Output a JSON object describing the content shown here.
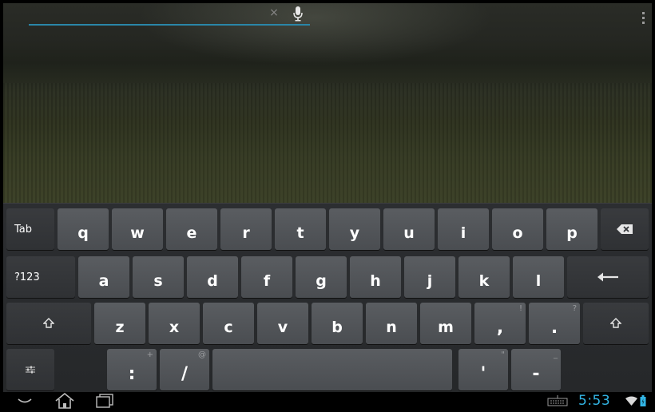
{
  "search": {
    "value": "",
    "placeholder": "",
    "clear_glyph": "×",
    "icons": {
      "clear": "close-icon",
      "voice": "microphone-icon",
      "menu": "overflow-menu-icon"
    }
  },
  "keyboard": {
    "row1": {
      "tab_label": "Tab",
      "letters": [
        "q",
        "w",
        "e",
        "r",
        "t",
        "y",
        "u",
        "i",
        "o",
        "p"
      ],
      "backspace_icon": "backspace-icon"
    },
    "row2": {
      "symbols_label": "?123",
      "letters": [
        "a",
        "s",
        "d",
        "f",
        "g",
        "h",
        "j",
        "k",
        "l"
      ],
      "enter_icon": "enter-arrow-icon"
    },
    "row3": {
      "shift_icon": "shift-arrow-icon",
      "letters": [
        "z",
        "x",
        "c",
        "v",
        "b",
        "n",
        "m"
      ],
      "comma": ",",
      "comma_hint": "!",
      "period": ".",
      "period_hint": "?"
    },
    "row4": {
      "settings_icon": "settings-sliders-icon",
      "colon": ":",
      "colon_hint": "+",
      "slash": "/",
      "slash_hint": "@",
      "apostrophe": "'",
      "apostrophe_hint": "\"",
      "dash": "-",
      "dash_hint": "_"
    }
  },
  "navbar": {
    "icons": [
      "back-hide-keyboard-icon",
      "home-icon",
      "recent-apps-icon"
    ],
    "status_icons": [
      "keyboard-icon",
      "wifi-icon",
      "battery-icon"
    ],
    "time": "5:53"
  },
  "colors": {
    "accent": "#32b5e5",
    "key": "#4f5256",
    "function_key": "#333538",
    "underline": "#2a86a8"
  }
}
